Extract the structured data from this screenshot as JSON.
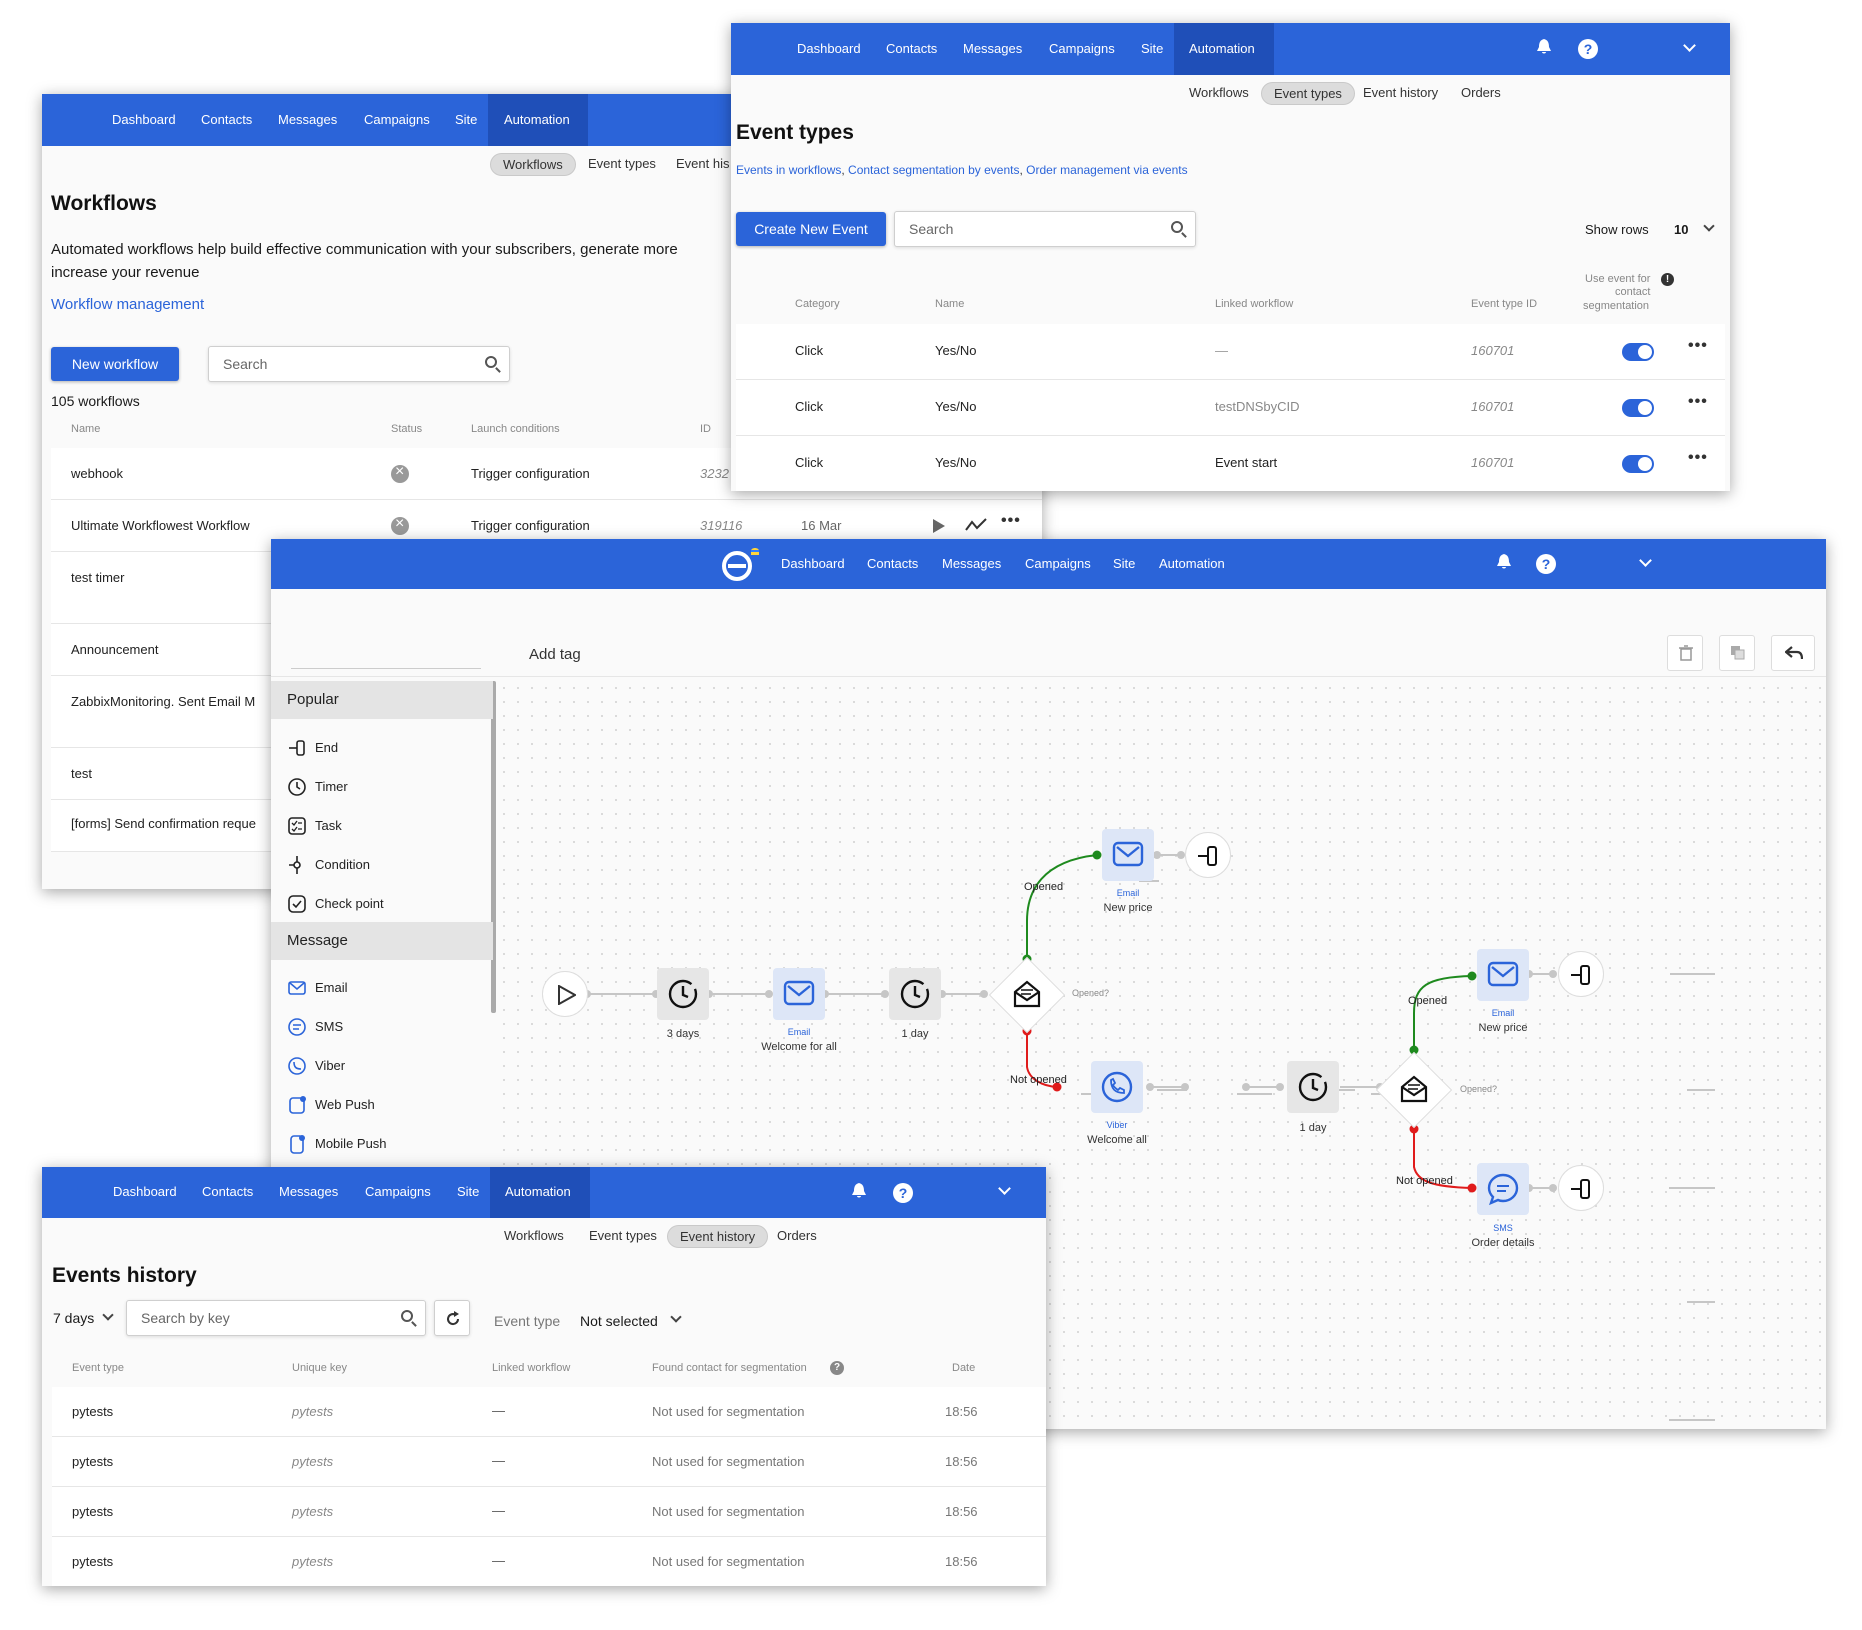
{
  "nav": {
    "dashboard": "Dashboard",
    "contacts": "Contacts",
    "messages": "Messages",
    "campaigns": "Campaigns",
    "site": "Site",
    "automation": "Automation"
  },
  "subtabs": {
    "workflows": "Workflows",
    "event_types": "Event types",
    "event_history": "Event history",
    "event_history_cut": "Event his",
    "orders": "Orders"
  },
  "workflows_panel": {
    "title": "Workflows",
    "description_line1": "Automated workflows help build effective communication with your subscribers, generate more",
    "description_line2": "increase your revenue",
    "help_link": "Workflow management",
    "new_button": "New workflow",
    "search_placeholder": "Search",
    "count": "105 workflows",
    "columns": {
      "name": "Name",
      "status": "Status",
      "launch": "Launch conditions",
      "id": "ID"
    },
    "rows": [
      {
        "name": "webhook",
        "launch": "Trigger configuration",
        "id": "3232"
      },
      {
        "name": "Ultimate Workflowest Workflow",
        "launch": "Trigger configuration",
        "id": "319116",
        "date": "16 Mar"
      },
      {
        "name": "test timer"
      },
      {
        "name": "Announcement"
      },
      {
        "name": "ZabbixMonitoring. Sent Email M"
      },
      {
        "name": "test"
      },
      {
        "name": "[forms] Send confirmation reque"
      }
    ]
  },
  "event_types_panel": {
    "title": "Event types",
    "links": {
      "a": "Events in workflows",
      "sep1": ", ",
      "b": "Contact segmentation by events",
      "sep2": ", ",
      "c": "Order management via events"
    },
    "create_button": "Create New Event",
    "search_placeholder": "Search",
    "show_rows_label": "Show rows",
    "show_rows_value": "10",
    "columns": {
      "category": "Category",
      "name": "Name",
      "linked": "Linked workflow",
      "type_id": "Event type ID",
      "use_line1": "Use event for",
      "use_line2": "contact",
      "use_line3": "segmentation"
    },
    "rows": [
      {
        "category": "Click",
        "name": "Yes/No",
        "linked": "—",
        "type_id": "160701"
      },
      {
        "category": "Click",
        "name": "Yes/No",
        "linked": "testDNSbyCID",
        "type_id": "160701"
      },
      {
        "category": "Click",
        "name": "Yes/No",
        "linked": "Event start",
        "type_id": "160701"
      }
    ]
  },
  "editor_panel": {
    "tag_label": "Add tag",
    "sidebar": {
      "popular": "Popular",
      "popular_items": [
        "End",
        "Timer",
        "Task",
        "Condition",
        "Check point"
      ],
      "message": "Message",
      "message_items": [
        "Email",
        "SMS",
        "Viber",
        "Web Push",
        "Mobile Push"
      ]
    },
    "flow": {
      "timer1": "3 days",
      "email1_type": "Email",
      "email1_name": "Welcome for all",
      "timer2": "1 day",
      "opened": "Opened",
      "opened_q": "Opened?",
      "not_opened": "Not opened",
      "email_top_type": "Email",
      "email_top_name": "New price",
      "viber_type": "Viber",
      "viber_name": "Welcome all",
      "timer3": "1 day",
      "opened2": "Opened",
      "opened_q2": "Opened?",
      "not_opened2": "Not opened",
      "email_right_type": "Email",
      "email_right_name": "New price",
      "sms_type": "SMS",
      "sms_name": "Order details"
    }
  },
  "history_panel": {
    "title": "Events history",
    "period": "7 days",
    "search_placeholder": "Search by key",
    "event_type_label": "Event type",
    "event_type_value": "Not selected",
    "columns": {
      "event_type": "Event type",
      "unique_key": "Unique key",
      "linked": "Linked workflow",
      "found": "Found contact for segmentation",
      "date": "Date"
    },
    "rows": [
      {
        "event_type": "pytests",
        "key": "pytests",
        "linked": "—",
        "found": "Not used for segmentation",
        "date": "18:56"
      },
      {
        "event_type": "pytests",
        "key": "pytests",
        "linked": "—",
        "found": "Not used for segmentation",
        "date": "18:56"
      },
      {
        "event_type": "pytests",
        "key": "pytests",
        "linked": "—",
        "found": "Not used for segmentation",
        "date": "18:56"
      },
      {
        "event_type": "pytests",
        "key": "pytests",
        "linked": "—",
        "found": "Not used for segmentation",
        "date": "18:56"
      }
    ]
  },
  "colors": {
    "brand": "#2b64d9",
    "green": "#1e8a1e",
    "red": "#e01b1b"
  }
}
